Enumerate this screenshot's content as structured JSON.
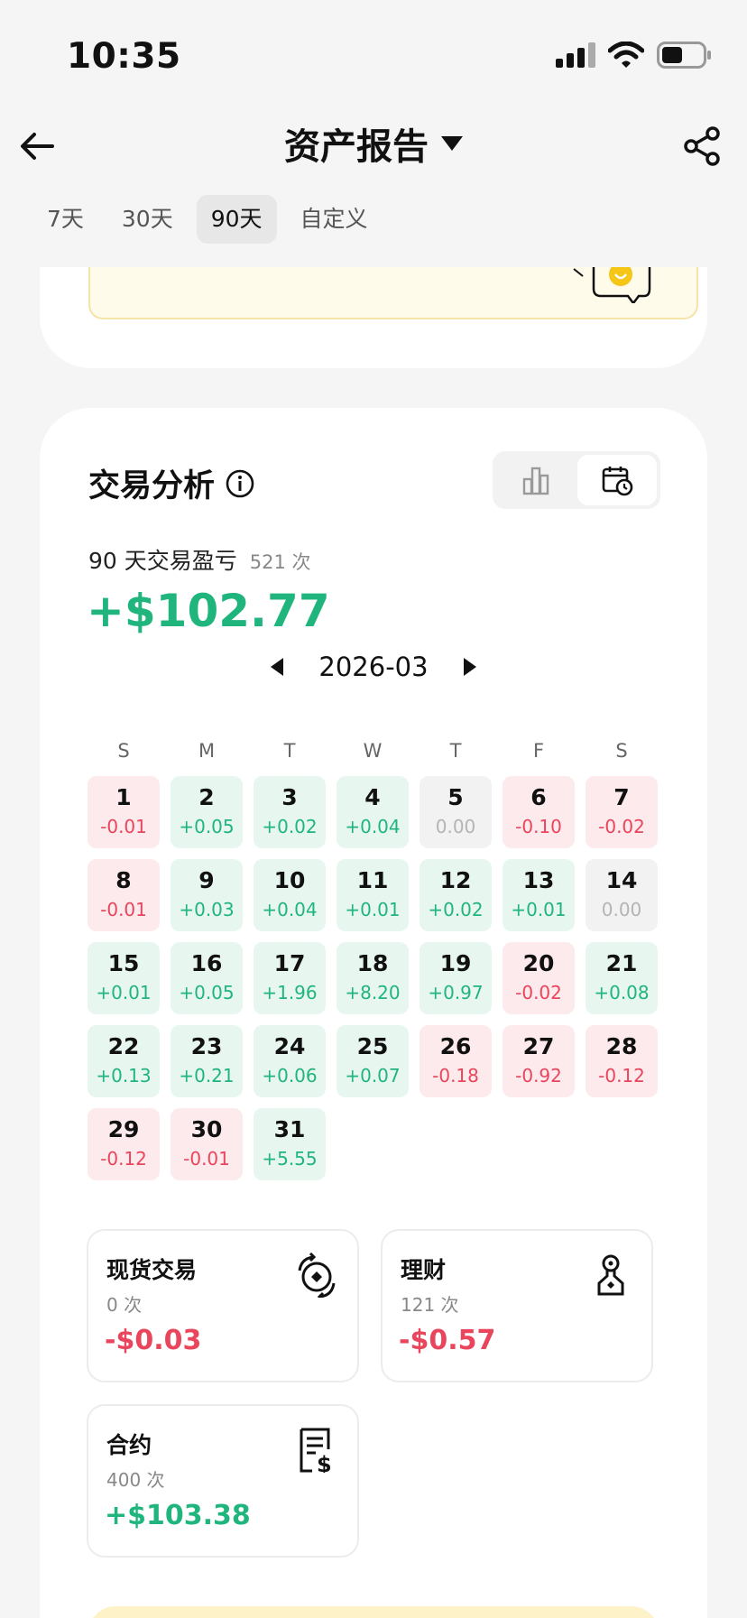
{
  "status_bar": {
    "time": "10:35"
  },
  "header": {
    "title": "资产报告"
  },
  "tabs": [
    {
      "label": "7天",
      "active": false
    },
    {
      "label": "30天",
      "active": false
    },
    {
      "label": "90天",
      "active": true
    },
    {
      "label": "自定义",
      "active": false
    }
  ],
  "analysis": {
    "title": "交易分析",
    "pnl_label": "90 天交易盈亏",
    "pnl_count": "521 次",
    "pnl_value": "+$102.77",
    "month": "2026-03",
    "weekdays": [
      "S",
      "M",
      "T",
      "W",
      "T",
      "F",
      "S"
    ],
    "days": [
      {
        "d": "1",
        "v": "-0.01",
        "s": "neg"
      },
      {
        "d": "2",
        "v": "+0.05",
        "s": "pos"
      },
      {
        "d": "3",
        "v": "+0.02",
        "s": "pos"
      },
      {
        "d": "4",
        "v": "+0.04",
        "s": "pos"
      },
      {
        "d": "5",
        "v": "0.00",
        "s": "zero"
      },
      {
        "d": "6",
        "v": "-0.10",
        "s": "neg"
      },
      {
        "d": "7",
        "v": "-0.02",
        "s": "neg"
      },
      {
        "d": "8",
        "v": "-0.01",
        "s": "neg"
      },
      {
        "d": "9",
        "v": "+0.03",
        "s": "pos"
      },
      {
        "d": "10",
        "v": "+0.04",
        "s": "pos"
      },
      {
        "d": "11",
        "v": "+0.01",
        "s": "pos"
      },
      {
        "d": "12",
        "v": "+0.02",
        "s": "pos"
      },
      {
        "d": "13",
        "v": "+0.01",
        "s": "pos"
      },
      {
        "d": "14",
        "v": "0.00",
        "s": "zero"
      },
      {
        "d": "15",
        "v": "+0.01",
        "s": "pos"
      },
      {
        "d": "16",
        "v": "+0.05",
        "s": "pos"
      },
      {
        "d": "17",
        "v": "+1.96",
        "s": "pos"
      },
      {
        "d": "18",
        "v": "+8.20",
        "s": "pos"
      },
      {
        "d": "19",
        "v": "+0.97",
        "s": "pos"
      },
      {
        "d": "20",
        "v": "-0.02",
        "s": "neg"
      },
      {
        "d": "21",
        "v": "+0.08",
        "s": "pos"
      },
      {
        "d": "22",
        "v": "+0.13",
        "s": "pos"
      },
      {
        "d": "23",
        "v": "+0.21",
        "s": "pos"
      },
      {
        "d": "24",
        "v": "+0.06",
        "s": "pos"
      },
      {
        "d": "25",
        "v": "+0.07",
        "s": "pos"
      },
      {
        "d": "26",
        "v": "-0.18",
        "s": "neg"
      },
      {
        "d": "27",
        "v": "-0.92",
        "s": "neg"
      },
      {
        "d": "28",
        "v": "-0.12",
        "s": "neg"
      },
      {
        "d": "29",
        "v": "-0.12",
        "s": "neg"
      },
      {
        "d": "30",
        "v": "-0.01",
        "s": "neg"
      },
      {
        "d": "31",
        "v": "+5.55",
        "s": "pos"
      }
    ],
    "spot": {
      "name": "现货交易",
      "count": "0 次",
      "value": "-$0.03",
      "icon": "spot-exchange-icon"
    },
    "earn": {
      "name": "理财",
      "count": "121 次",
      "value": "-$0.57",
      "icon": "earn-icon"
    },
    "futures": {
      "name": "合约",
      "count": "400 次",
      "value": "+$103.38",
      "icon": "contract-icon"
    }
  },
  "colors": {
    "positive": "#21b57e",
    "negative": "#e9455d",
    "neutral": "#b4b4b4"
  }
}
